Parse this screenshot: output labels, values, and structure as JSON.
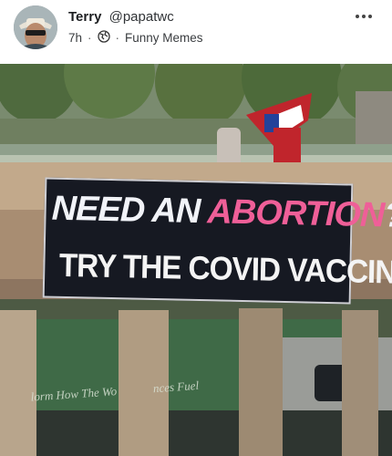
{
  "post": {
    "display_name": "Terry",
    "handle": "@papatwc",
    "time": "7h",
    "separator": "·",
    "visibility_icon": "globe-icon",
    "group": "Funny Memes",
    "more_icon": "more-options-icon"
  },
  "image": {
    "banner": {
      "line1_part1": "NEED AN ",
      "line1_pink": "ABORTION",
      "line1_end": "?",
      "line2": "TRY THE COVID VACCINE"
    },
    "background_sign_left": "lorm How The Wo",
    "background_sign_right": "nces Fuel"
  },
  "colors": {
    "banner_bg": "#161922",
    "banner_pink": "#ef5f98",
    "banner_white": "#f1f3f8"
  }
}
